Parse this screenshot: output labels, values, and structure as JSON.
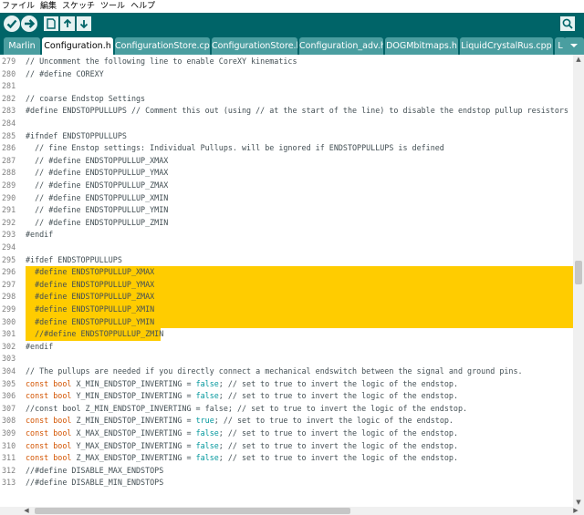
{
  "menu": [
    "ファイル",
    "編集",
    "スケッチ",
    "ツール",
    "ヘルプ"
  ],
  "toolbar": {
    "buttons": [
      "verify-icon",
      "upload-icon",
      "new-icon",
      "open-icon",
      "save-icon"
    ],
    "serial_monitor": "serial-monitor-icon"
  },
  "tabs": [
    "Marlin",
    "Configuration.h",
    "ConfigurationStore.cpp",
    "ConfigurationStore.h",
    "Configuration_adv.h",
    "DOGMbitmaps.h",
    "LiquidCrystalRus.cpp",
    "L"
  ],
  "active_tab": "Configuration.h",
  "editor": {
    "lines": [
      {
        "n": "279",
        "t": "// Uncomment the following line to enable CoreXY kinematics"
      },
      {
        "n": "280",
        "t": "// #define COREXY"
      },
      {
        "n": "281",
        "t": ""
      },
      {
        "n": "282",
        "t": "// coarse Endstop Settings"
      },
      {
        "n": "283",
        "t": "#define ENDSTOPPULLUPS // Comment this out (using // at the start of the line) to disable the endstop pullup resistors"
      },
      {
        "n": "284",
        "t": ""
      },
      {
        "n": "285",
        "t": "#ifndef ENDSTOPPULLUPS"
      },
      {
        "n": "286",
        "t": "  // fine Enstop settings: Individual Pullups. will be ignored if ENDSTOPPULLUPS is defined"
      },
      {
        "n": "287",
        "t": "  // #define ENDSTOPPULLUP_XMAX"
      },
      {
        "n": "288",
        "t": "  // #define ENDSTOPPULLUP_YMAX"
      },
      {
        "n": "289",
        "t": "  // #define ENDSTOPPULLUP_ZMAX"
      },
      {
        "n": "290",
        "t": "  // #define ENDSTOPPULLUP_XMIN"
      },
      {
        "n": "291",
        "t": "  // #define ENDSTOPPULLUP_YMIN"
      },
      {
        "n": "292",
        "t": "  // #define ENDSTOPPULLUP_ZMIN"
      },
      {
        "n": "293",
        "t": "#endif"
      },
      {
        "n": "294",
        "t": ""
      },
      {
        "n": "295",
        "t": "#ifdef ENDSTOPPULLUPS"
      },
      {
        "n": "296",
        "t": "  #define ENDSTOPPULLUP_XMAX"
      },
      {
        "n": "297",
        "t": "  #define ENDSTOPPULLUP_YMAX"
      },
      {
        "n": "298",
        "t": "  #define ENDSTOPPULLUP_ZMAX"
      },
      {
        "n": "299",
        "t": "  #define ENDSTOPPULLUP_XMIN"
      },
      {
        "n": "300",
        "t": "  #define ENDSTOPPULLUP_YMIN"
      },
      {
        "n": "301",
        "t": "  //#define ENDSTOPPULLUP_ZMIN"
      },
      {
        "n": "302",
        "t": "#endif"
      },
      {
        "n": "303",
        "t": ""
      },
      {
        "n": "304",
        "t": "// The pullups are needed if you directly connect a mechanical endswitch between the signal and ground pins."
      },
      {
        "n": "305",
        "t": "const bool X_MIN_ENDSTOP_INVERTING = false; // set to true to invert the logic of the endstop."
      },
      {
        "n": "306",
        "t": "const bool Y_MIN_ENDSTOP_INVERTING = false; // set to true to invert the logic of the endstop."
      },
      {
        "n": "307",
        "t": "//const bool Z_MIN_ENDSTOP_INVERTING = false; // set to true to invert the logic of the endstop."
      },
      {
        "n": "308",
        "t": "const bool Z_MIN_ENDSTOP_INVERTING = true; // set to true to invert the logic of the endstop."
      },
      {
        "n": "309",
        "t": "const bool X_MAX_ENDSTOP_INVERTING = false; // set to true to invert the logic of the endstop."
      },
      {
        "n": "310",
        "t": "const bool Y_MAX_ENDSTOP_INVERTING = false; // set to true to invert the logic of the endstop."
      },
      {
        "n": "311",
        "t": "const bool Z_MAX_ENDSTOP_INVERTING = false; // set to true to invert the logic of the endstop."
      },
      {
        "n": "312",
        "t": "//#define DISABLE_MAX_ENDSTOPS"
      },
      {
        "n": "313",
        "t": "//#define DISABLE_MIN_ENDSTOPS"
      }
    ],
    "highlighted_lines": [
      "296",
      "297",
      "298",
      "299",
      "300",
      "301"
    ]
  },
  "colors": {
    "toolbar": "#006468",
    "tab": "#4a9ea0",
    "highlight": "#ffcc00",
    "keyword": "#00979c",
    "type_keyword": "#d35400",
    "comment_text": "#434f54"
  }
}
